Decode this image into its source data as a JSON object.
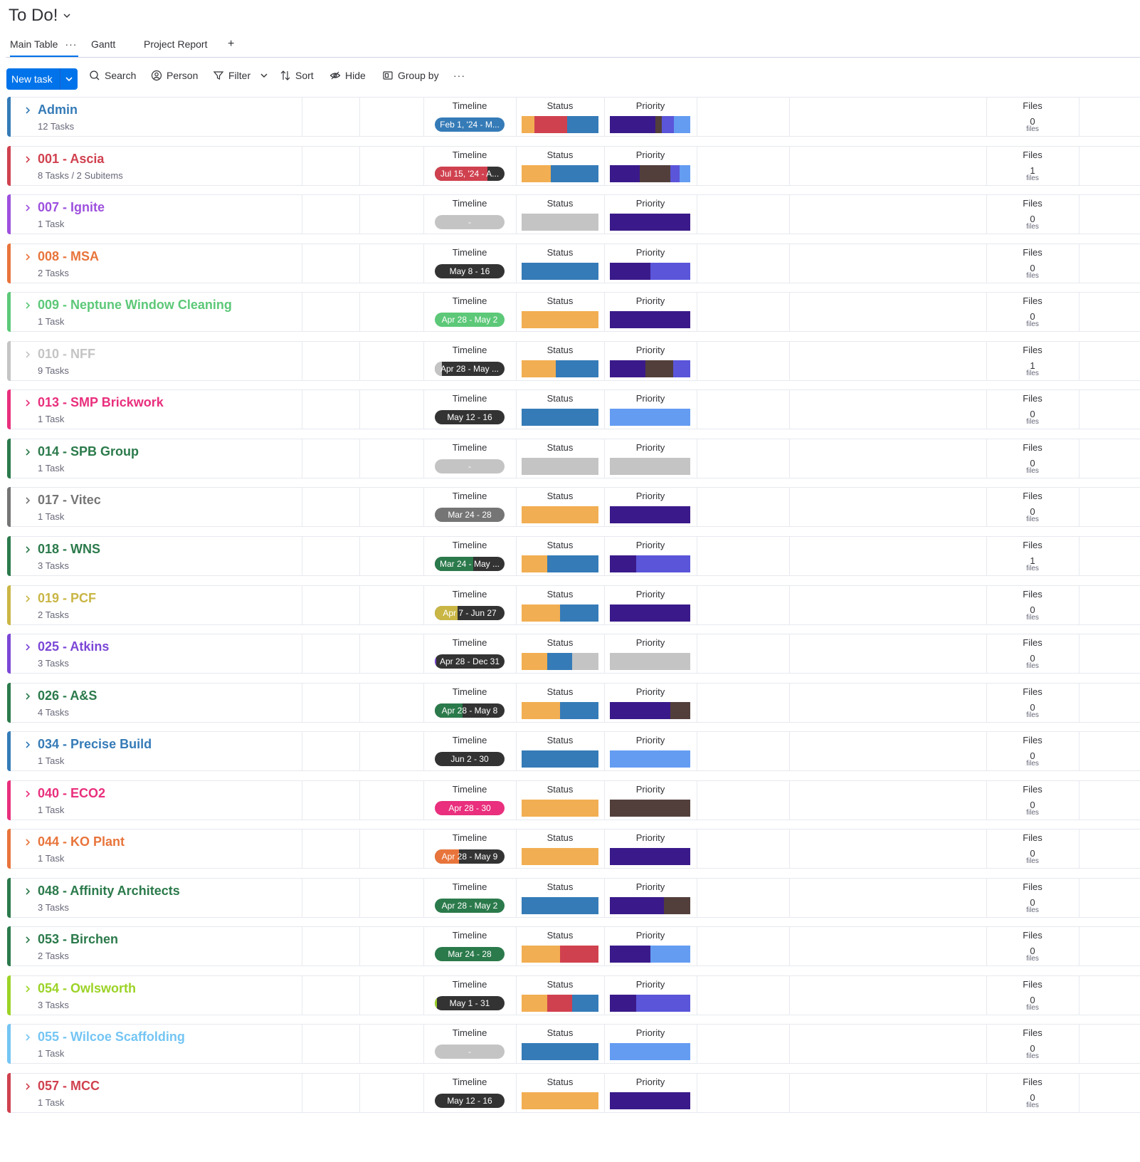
{
  "board": {
    "title": "To Do!"
  },
  "tabs": [
    {
      "label": "Main Table",
      "dots": "···"
    },
    {
      "label": "Gantt"
    },
    {
      "label": "Project Report"
    },
    {
      "label": "+"
    }
  ],
  "toolbar": {
    "new_task": "New task",
    "search": "Search",
    "person": "Person",
    "filter": "Filter",
    "sort": "Sort",
    "hide": "Hide",
    "group_by": "Group by",
    "more": "···"
  },
  "columns": {
    "timeline": "Timeline",
    "status": "Status",
    "priority": "Priority",
    "files": "Files"
  },
  "colors": {
    "status_orange": "#f2ae52",
    "status_red": "#d0414f",
    "status_blue": "#357bb7",
    "status_grey": "#c4c4c4",
    "priority_dark": "#3a1a8a",
    "priority_brown": "#523f3b",
    "priority_purple": "#5a55d9",
    "priority_light": "#649cf2",
    "accent": "#0073ea"
  },
  "groups": [
    {
      "name": "Admin",
      "count": "12 Tasks",
      "color": "#357bb7",
      "timeline": "Feb 1, '24 - M...",
      "tl_bg": "#357bb7",
      "tl_fill": 0,
      "tl_fill_color": "#357bb7",
      "status": [
        [
          "#f2ae52",
          0.17
        ],
        [
          "#d0414f",
          0.42
        ],
        [
          "#357bb7",
          0.41
        ]
      ],
      "priority": [
        [
          "#3a1a8a",
          0.57
        ],
        [
          "#523f3b",
          0.08
        ],
        [
          "#5a55d9",
          0.15
        ],
        [
          "#649cf2",
          0.2
        ]
      ],
      "files": "0"
    },
    {
      "name": "001 - Ascia",
      "count": "8 Tasks / 2 Subitems",
      "color": "#d0414f",
      "timeline": "Jul 15, '24 - A...",
      "tl_bg": "#333333",
      "tl_fill": 0.75,
      "tl_fill_color": "#d0414f",
      "status": [
        [
          "#f2ae52",
          0.38
        ],
        [
          "#357bb7",
          0.62
        ]
      ],
      "priority": [
        [
          "#3a1a8a",
          0.37
        ],
        [
          "#523f3b",
          0.38
        ],
        [
          "#5a55d9",
          0.12
        ],
        [
          "#649cf2",
          0.13
        ]
      ],
      "files": "1"
    },
    {
      "name": "007 - Ignite",
      "count": "1 Task",
      "color": "#9d50dd",
      "timeline": "-",
      "tl_bg": "#c4c4c4",
      "tl_fill": 0,
      "tl_fill_color": "#c4c4c4",
      "status": [
        [
          "#c4c4c4",
          1
        ]
      ],
      "priority": [
        [
          "#3a1a8a",
          1
        ]
      ],
      "files": "0"
    },
    {
      "name": "008 - MSA",
      "count": "2 Tasks",
      "color": "#e8743b",
      "timeline": "May 8 - 16",
      "tl_bg": "#333333",
      "tl_fill": 0,
      "tl_fill_color": "#333333",
      "status": [
        [
          "#357bb7",
          1
        ]
      ],
      "priority": [
        [
          "#3a1a8a",
          0.5
        ],
        [
          "#5a55d9",
          0.5
        ]
      ],
      "files": "0"
    },
    {
      "name": "009 - Neptune Window Cleaning",
      "count": "1 Task",
      "color": "#5cc878",
      "timeline": "Apr 28 - May 2",
      "tl_bg": "#5cc878",
      "tl_fill": 0,
      "tl_fill_color": "#5cc878",
      "status": [
        [
          "#f2ae52",
          1
        ]
      ],
      "priority": [
        [
          "#3a1a8a",
          1
        ]
      ],
      "files": "0"
    },
    {
      "name": "010 - NFF",
      "count": "9 Tasks",
      "color": "#c4c4c4",
      "timeline": "Apr 28 - May ...",
      "tl_bg": "#333333",
      "tl_fill": 0.1,
      "tl_fill_color": "#c4c4c4",
      "status": [
        [
          "#f2ae52",
          0.44
        ],
        [
          "#357bb7",
          0.56
        ]
      ],
      "priority": [
        [
          "#3a1a8a",
          0.44
        ],
        [
          "#523f3b",
          0.35
        ],
        [
          "#5a55d9",
          0.21
        ]
      ],
      "files": "1"
    },
    {
      "name": "013 - SMP Brickwork",
      "count": "1 Task",
      "color": "#e92f7d",
      "timeline": "May 12 - 16",
      "tl_bg": "#333333",
      "tl_fill": 0,
      "tl_fill_color": "#333333",
      "status": [
        [
          "#357bb7",
          1
        ]
      ],
      "priority": [
        [
          "#649cf2",
          1
        ]
      ],
      "files": "0"
    },
    {
      "name": "014 - SPB Group",
      "count": "1 Task",
      "color": "#2b7a4b",
      "timeline": "-",
      "tl_bg": "#c4c4c4",
      "tl_fill": 0,
      "tl_fill_color": "#c4c4c4",
      "status": [
        [
          "#c4c4c4",
          1
        ]
      ],
      "priority": [
        [
          "#c4c4c4",
          1
        ]
      ],
      "files": "0"
    },
    {
      "name": "017 - Vitec",
      "count": "1 Task",
      "color": "#757575",
      "timeline": "Mar 24 - 28",
      "tl_bg": "#757575",
      "tl_fill": 0,
      "tl_fill_color": "#757575",
      "status": [
        [
          "#f2ae52",
          1
        ]
      ],
      "priority": [
        [
          "#3a1a8a",
          1
        ]
      ],
      "files": "0"
    },
    {
      "name": "018 - WNS",
      "count": "3 Tasks",
      "color": "#2b7a4b",
      "timeline": "Mar 24 - May ...",
      "tl_bg": "#333333",
      "tl_fill": 0.55,
      "tl_fill_color": "#2b7a4b",
      "status": [
        [
          "#f2ae52",
          0.33
        ],
        [
          "#357bb7",
          0.67
        ]
      ],
      "priority": [
        [
          "#3a1a8a",
          0.33
        ],
        [
          "#5a55d9",
          0.67
        ]
      ],
      "files": "1"
    },
    {
      "name": "019 - PCF",
      "count": "2 Tasks",
      "color": "#c9b645",
      "timeline": "Apr 7 - Jun 27",
      "tl_bg": "#333333",
      "tl_fill": 0.33,
      "tl_fill_color": "#c9b645",
      "status": [
        [
          "#f2ae52",
          0.5
        ],
        [
          "#357bb7",
          0.5
        ]
      ],
      "priority": [
        [
          "#3a1a8a",
          1
        ]
      ],
      "files": "0"
    },
    {
      "name": "025 - Atkins",
      "count": "3 Tasks",
      "color": "#7b47d6",
      "timeline": "Apr 28 - Dec 31",
      "tl_bg": "#333333",
      "tl_fill": 0.02,
      "tl_fill_color": "#7b47d6",
      "status": [
        [
          "#f2ae52",
          0.33
        ],
        [
          "#357bb7",
          0.33
        ],
        [
          "#c4c4c4",
          0.34
        ]
      ],
      "priority": [
        [
          "#c4c4c4",
          1
        ]
      ],
      "files": "0"
    },
    {
      "name": "026 - A&S",
      "count": "4 Tasks",
      "color": "#2b7a4b",
      "timeline": "Apr 28 - May 8",
      "tl_bg": "#333333",
      "tl_fill": 0.4,
      "tl_fill_color": "#2b7a4b",
      "status": [
        [
          "#f2ae52",
          0.5
        ],
        [
          "#357bb7",
          0.5
        ]
      ],
      "priority": [
        [
          "#3a1a8a",
          0.75
        ],
        [
          "#523f3b",
          0.25
        ]
      ],
      "files": "0"
    },
    {
      "name": "034 - Precise Build",
      "count": "1 Task",
      "color": "#357bb7",
      "timeline": "Jun 2 - 30",
      "tl_bg": "#333333",
      "tl_fill": 0,
      "tl_fill_color": "#333333",
      "status": [
        [
          "#357bb7",
          1
        ]
      ],
      "priority": [
        [
          "#649cf2",
          1
        ]
      ],
      "files": "0"
    },
    {
      "name": "040 - ECO2",
      "count": "1 Task",
      "color": "#e92f7d",
      "timeline": "Apr 28 - 30",
      "tl_bg": "#e92f7d",
      "tl_fill": 0,
      "tl_fill_color": "#e92f7d",
      "status": [
        [
          "#f2ae52",
          1
        ]
      ],
      "priority": [
        [
          "#523f3b",
          1
        ]
      ],
      "files": "0"
    },
    {
      "name": "044 - KO Plant",
      "count": "1 Task",
      "color": "#e8743b",
      "timeline": "Apr 28 - May 9",
      "tl_bg": "#333333",
      "tl_fill": 0.35,
      "tl_fill_color": "#e8743b",
      "status": [
        [
          "#f2ae52",
          1
        ]
      ],
      "priority": [
        [
          "#3a1a8a",
          1
        ]
      ],
      "files": "0"
    },
    {
      "name": "048 - Affinity Architects",
      "count": "3 Tasks",
      "color": "#2b7a4b",
      "timeline": "Apr 28 - May 2",
      "tl_bg": "#2b7a4b",
      "tl_fill": 0,
      "tl_fill_color": "#2b7a4b",
      "status": [
        [
          "#357bb7",
          1
        ]
      ],
      "priority": [
        [
          "#3a1a8a",
          0.67
        ],
        [
          "#523f3b",
          0.33
        ]
      ],
      "files": "0"
    },
    {
      "name": "053 - Birchen",
      "count": "2 Tasks",
      "color": "#2b7a4b",
      "timeline": "Mar 24 - 28",
      "tl_bg": "#2b7a4b",
      "tl_fill": 0,
      "tl_fill_color": "#2b7a4b",
      "status": [
        [
          "#f2ae52",
          0.5
        ],
        [
          "#d0414f",
          0.5
        ]
      ],
      "priority": [
        [
          "#3a1a8a",
          0.5
        ],
        [
          "#649cf2",
          0.5
        ]
      ],
      "files": "0"
    },
    {
      "name": "054 - Owlsworth",
      "count": "3 Tasks",
      "color": "#9cd326",
      "timeline": "May 1 - 31",
      "tl_bg": "#333333",
      "tl_fill": 0.03,
      "tl_fill_color": "#9cd326",
      "status": [
        [
          "#f2ae52",
          0.33
        ],
        [
          "#d0414f",
          0.33
        ],
        [
          "#357bb7",
          0.34
        ]
      ],
      "priority": [
        [
          "#3a1a8a",
          0.33
        ],
        [
          "#5a55d9",
          0.67
        ]
      ],
      "files": "0"
    },
    {
      "name": "055 - Wilcoe Scaffolding",
      "count": "1 Task",
      "color": "#74c5f4",
      "timeline": "-",
      "tl_bg": "#c4c4c4",
      "tl_fill": 0,
      "tl_fill_color": "#c4c4c4",
      "status": [
        [
          "#357bb7",
          1
        ]
      ],
      "priority": [
        [
          "#649cf2",
          1
        ]
      ],
      "files": "0"
    },
    {
      "name": "057 - MCC",
      "count": "1 Task",
      "color": "#d0414f",
      "timeline": "May 12 - 16",
      "tl_bg": "#333333",
      "tl_fill": 0,
      "tl_fill_color": "#333333",
      "status": [
        [
          "#f2ae52",
          1
        ]
      ],
      "priority": [
        [
          "#3a1a8a",
          1
        ]
      ],
      "files": "0"
    }
  ]
}
